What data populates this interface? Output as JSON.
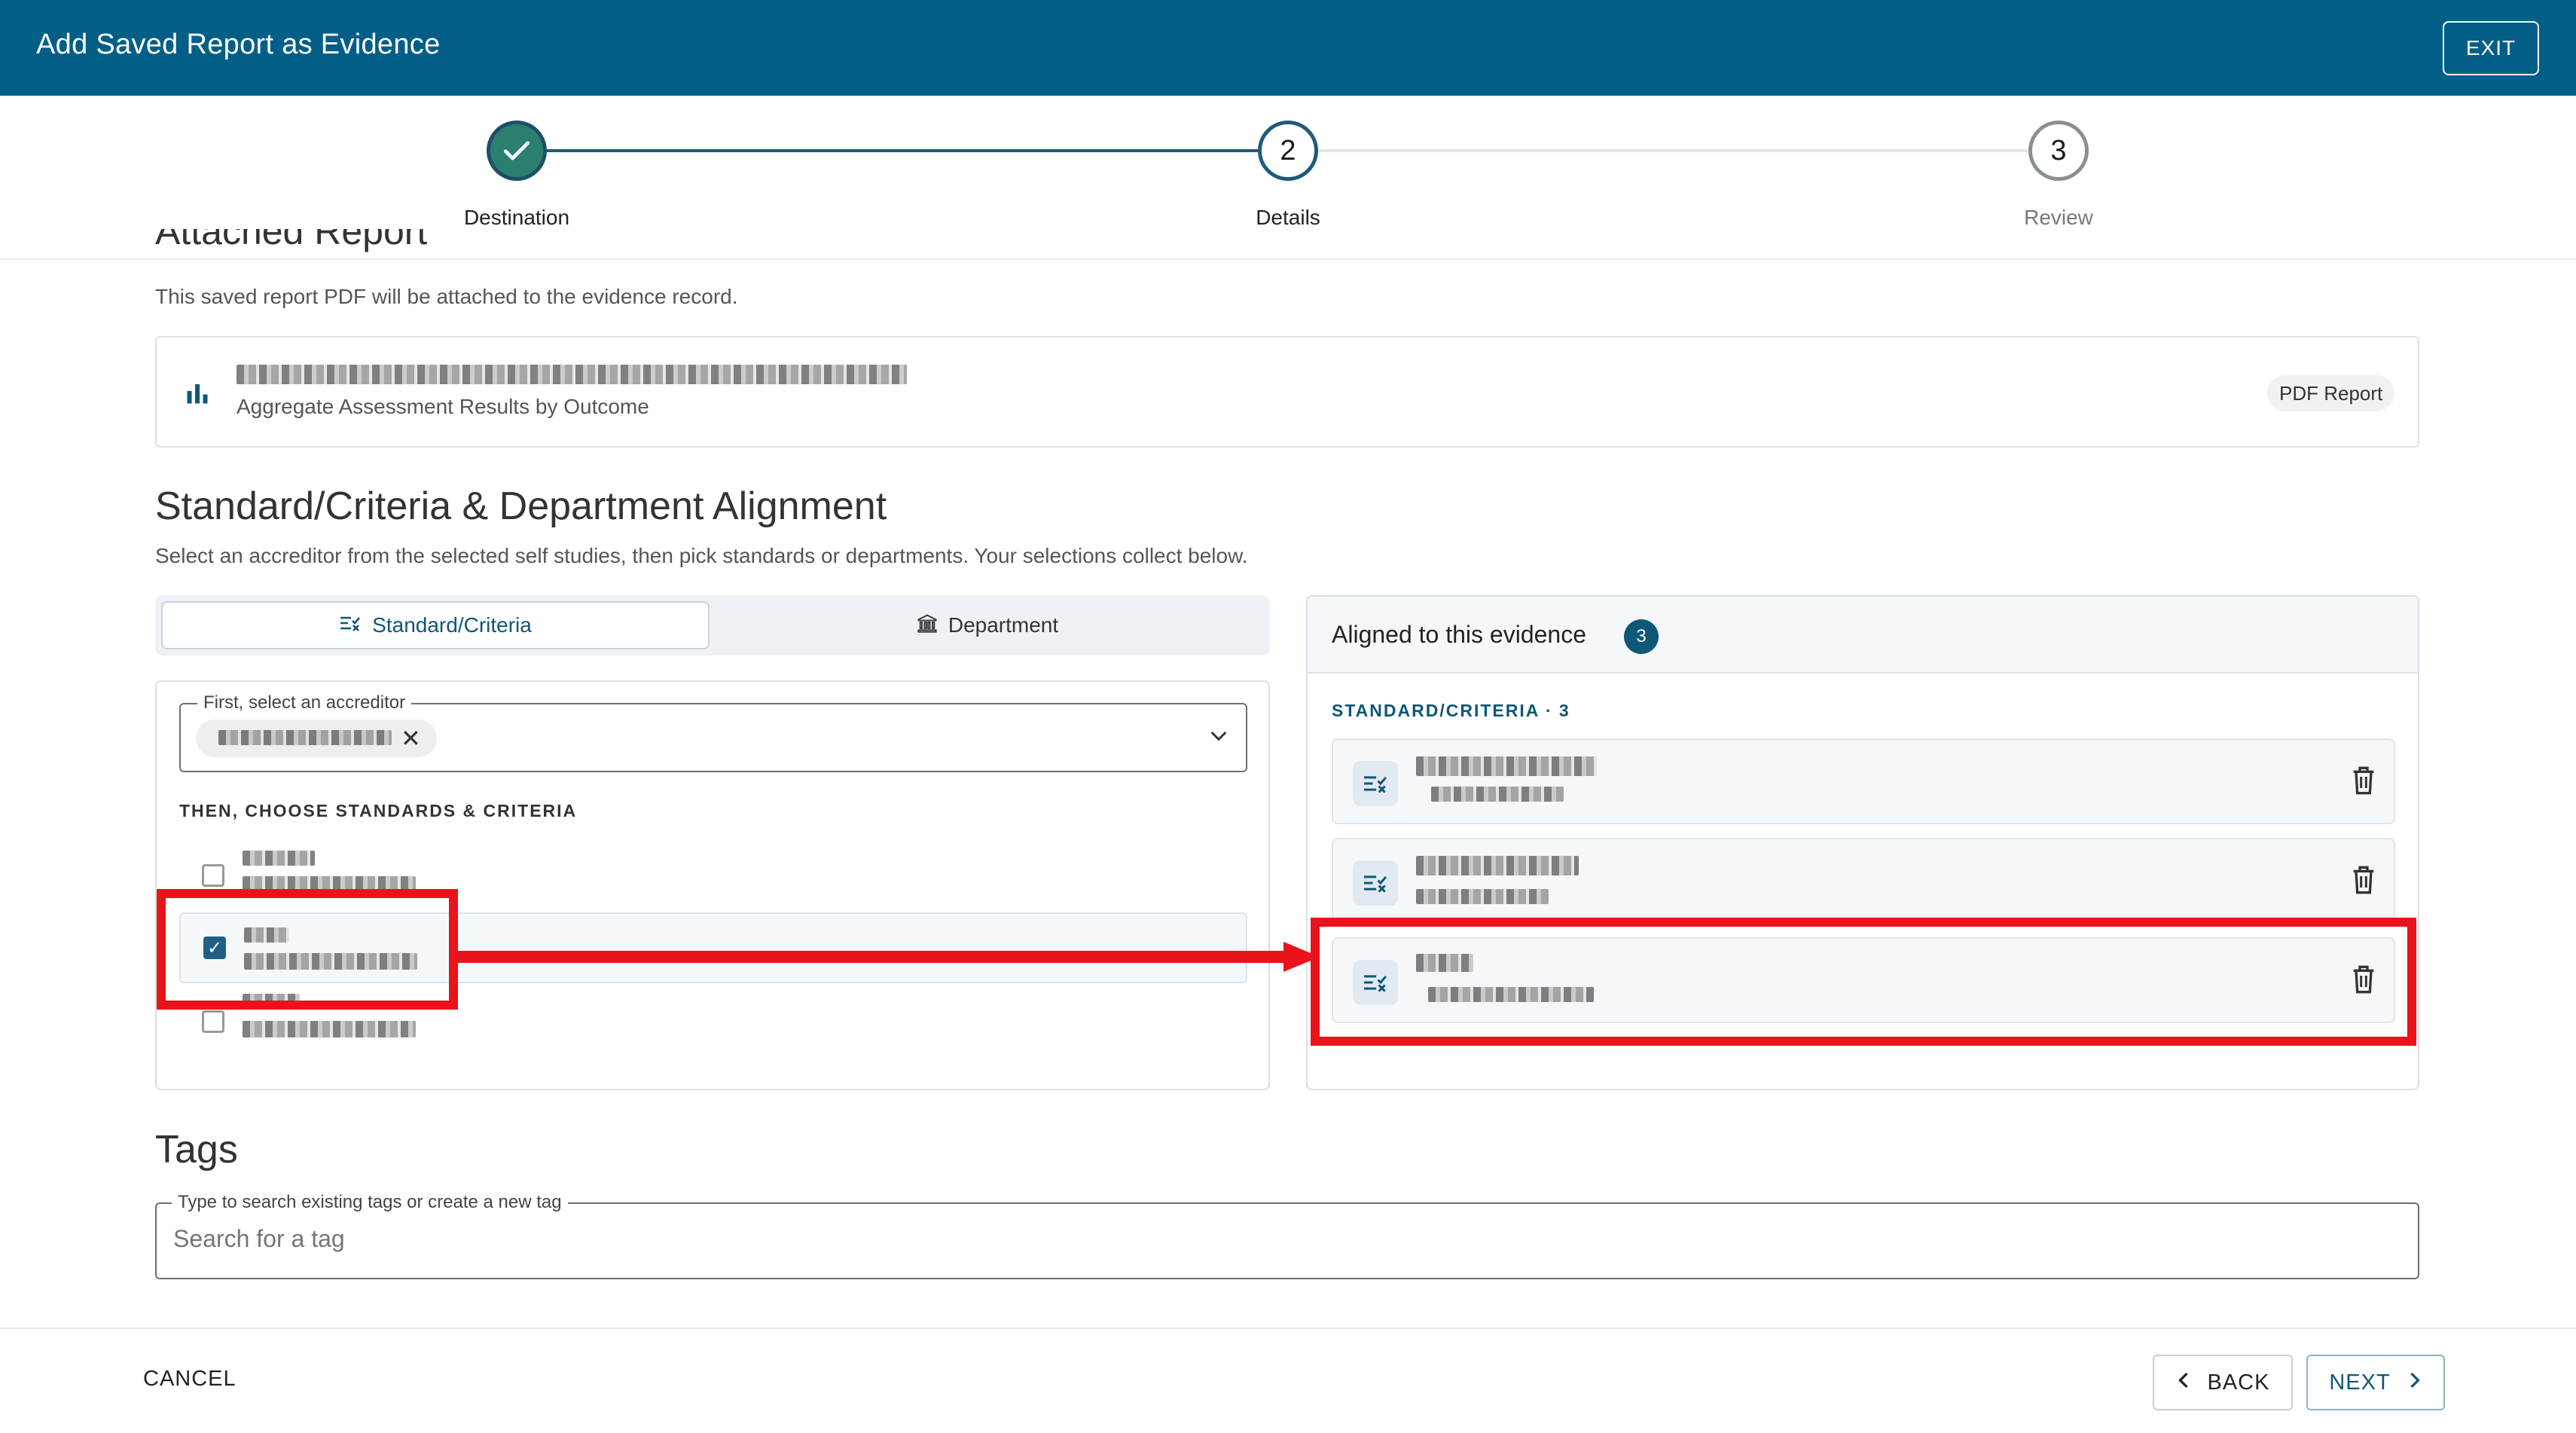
{
  "header": {
    "title": "Add Saved Report as Evidence",
    "exit_label": "EXIT"
  },
  "stepper": {
    "steps": [
      {
        "label": "Destination",
        "number": "",
        "state": "complete"
      },
      {
        "label": "Details",
        "number": "2",
        "state": "active"
      },
      {
        "label": "Review",
        "number": "3",
        "state": "pending"
      }
    ]
  },
  "attached_report": {
    "heading": "Attached Report",
    "description": "This saved report PDF will be attached to the evidence record.",
    "report_subtitle": "Aggregate Assessment Results by Outcome",
    "badge": "PDF Report"
  },
  "alignment": {
    "heading": "Standard/Criteria & Department Alignment",
    "description": "Select an accreditor from the selected self studies, then pick standards or departments. Your selections collect below.",
    "tabs": [
      {
        "label": "Standard/Criteria",
        "icon": "checklist-icon",
        "active": true
      },
      {
        "label": "Department",
        "icon": "bank-icon",
        "active": false
      }
    ],
    "accreditor_legend": "First, select an accreditor",
    "choose_overline": "THEN, CHOOSE STANDARDS & CRITERIA",
    "options": [
      {
        "checked": false
      },
      {
        "checked": true
      },
      {
        "checked": false
      }
    ],
    "aligned": {
      "title": "Aligned to this evidence",
      "count": "3",
      "overline": "STANDARD/CRITERIA · 3",
      "items": [
        {},
        {},
        {}
      ]
    }
  },
  "tags": {
    "heading": "Tags",
    "legend": "Type to search existing tags or create a new tag",
    "placeholder": "Search for a tag"
  },
  "footer": {
    "cancel_label": "CANCEL",
    "back_label": "BACK",
    "next_label": "NEXT"
  },
  "colors": {
    "brand": "#005e87",
    "complete": "#2a7f6f",
    "annotation": "#e8131b"
  }
}
